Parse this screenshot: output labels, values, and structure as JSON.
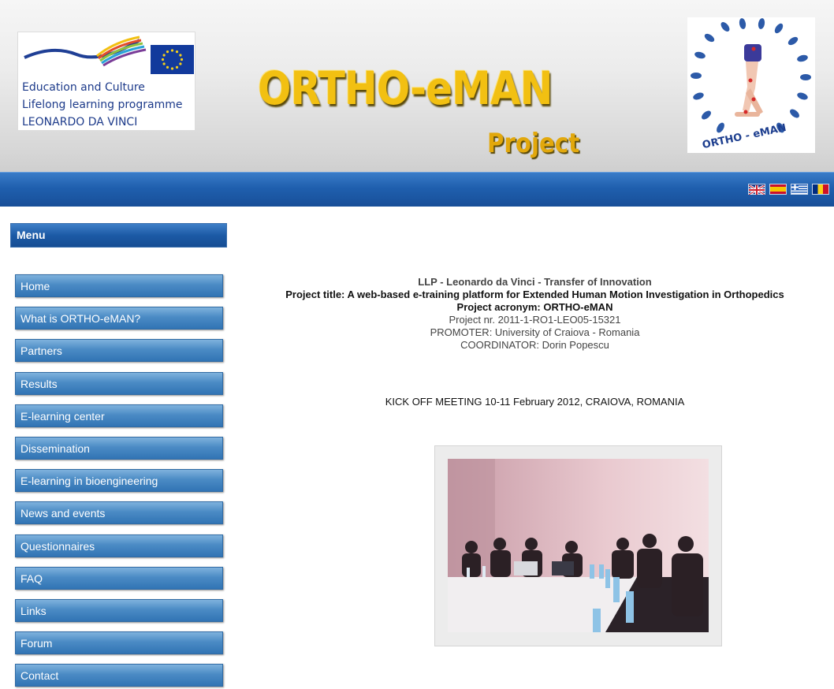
{
  "header": {
    "eu_logo": {
      "line1": "Education and Culture",
      "line2": "Lifelong learning programme",
      "line3": "LEONARDO DA VINCI"
    },
    "title": "ORTHO-eMAN",
    "subtitle": "Project",
    "project_logo_text": "ORTHO - eMAN"
  },
  "languages": [
    {
      "code": "en",
      "icon": "uk-flag-icon"
    },
    {
      "code": "es",
      "icon": "spain-flag-icon"
    },
    {
      "code": "el",
      "icon": "greece-flag-icon"
    },
    {
      "code": "ro",
      "icon": "romania-flag-icon"
    }
  ],
  "sidebar": {
    "menu_title": "Menu",
    "items": [
      {
        "label": "Home"
      },
      {
        "label": "What is ORTHO-eMAN?"
      },
      {
        "label": "Partners"
      },
      {
        "label": "Results"
      },
      {
        "label": "E-learning center"
      },
      {
        "label": "Dissemination"
      },
      {
        "label": "E-learning in bioengineering"
      },
      {
        "label": "News and events"
      },
      {
        "label": "Questionnaires"
      },
      {
        "label": "FAQ"
      },
      {
        "label": "Links"
      },
      {
        "label": "Forum"
      },
      {
        "label": "Contact"
      }
    ]
  },
  "main": {
    "programme": "LLP - Leonardo da Vinci - Transfer of Innovation",
    "project_title": "Project title: A web-based e-training platform for Extended Human Motion Investigation in Orthopedics",
    "project_acronym": "Project acronym: ORTHO-eMAN",
    "project_nr": "Project nr. 2011-1-RO1-LEO05-15321",
    "promoter": "PROMOTER: University of Craiova - Romania",
    "coordinator": "COORDINATOR: Dorin Popescu",
    "kickoff": "KICK OFF MEETING 10-11 February 2012, CRAIOVA, ROMANIA"
  },
  "colors": {
    "header_blue": "#1f5fae",
    "menu_button": "#4b8bc5",
    "title_gold": "#f2c012"
  }
}
